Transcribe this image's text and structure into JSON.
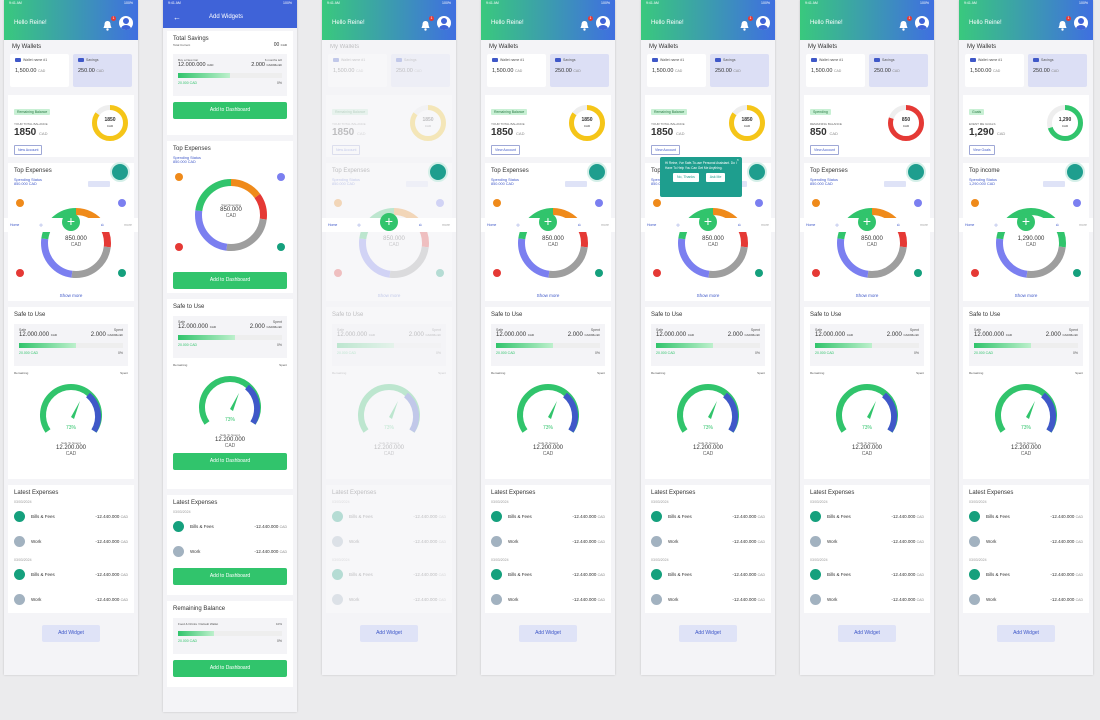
{
  "screens": [
    {
      "time": "9:41 AM",
      "battery": "100%",
      "greeting": "Hello Reine!",
      "notif": "1"
    },
    {
      "time": "9:41 AM",
      "battery": "100%",
      "title": "Add Widgets"
    }
  ],
  "wallets": {
    "title": "My Wallets",
    "items": [
      {
        "name": "Wallet name #1",
        "amount": "1,500.00",
        "cur": "CAD"
      },
      {
        "name": "Savings",
        "amount": "250.00",
        "cur": "CAD"
      }
    ]
  },
  "balance_widgets": [
    {
      "tag": "Remaining Balance",
      "label": "YOUR TOTAL BALANCE",
      "amount": "1850",
      "cur": "CAD",
      "button": "New Account"
    },
    {
      "tag": "Remaining Balance",
      "label": "YOUR TOTAL BALANCE",
      "amount": "1850",
      "cur": "CAD",
      "button": "View Account"
    },
    {
      "tag": "Spending",
      "label": "REMAINING BALANCE",
      "amount": "850",
      "cur": "CAD",
      "button": "View Account"
    },
    {
      "tag": "Goals",
      "label": "EVENT ME GOALS",
      "amount": "1,290",
      "cur": "CAD",
      "button": "View Goals"
    }
  ],
  "top_expenses": {
    "title": "Top Expenses",
    "status": "Spending Status",
    "amount": "850.000 CAD",
    "total": "850.000",
    "cur": "CAD",
    "show_more": "Show more",
    "center_label": "Total Spending"
  },
  "top_income": {
    "title": "Top income",
    "status": "Spending Status",
    "amount": "1,290.000 CAD",
    "total": "1,290.000",
    "cur": "CAD"
  },
  "nav": {
    "home": "Home",
    "more": "more"
  },
  "safe": {
    "title": "Safe to Use",
    "safe_lbl": "Safe",
    "spent_lbl": "Spent",
    "safe": "12.000.000",
    "safe_cur": "CAD",
    "spent": "2.000",
    "spent_cur": "CAD/Month",
    "prog_amt": "20.000 CAD",
    "prog_pct": "0%",
    "remaining": "Remaining",
    "spent2": "Spent",
    "pct": "73%",
    "status": "Safe To Spend",
    "total": "12.200.000",
    "cur": "CAD"
  },
  "latest": {
    "title": "Latest Expenses",
    "date": "03/03/2024",
    "items": [
      {
        "name": "Bills & Fees",
        "amount": "-12.440.000",
        "cur": "CAD"
      },
      {
        "name": "Work",
        "amount": "-12.440.000",
        "cur": "CAD"
      },
      {
        "name": "Bills & Fees",
        "amount": "-12.440.000",
        "cur": "CAD"
      },
      {
        "name": "Work",
        "amount": "-12.440.000",
        "cur": "CAD"
      }
    ]
  },
  "add_widget": "Add Widget",
  "add_dashboard": "Add to Dashboard",
  "widgets_page": {
    "total_savings": "Total Savings",
    "total_sub": "Total Current",
    "savings_count": "00",
    "savings_cur": "CAD",
    "goal_lbl": "Buy a New Car",
    "goal_period": "6 months left",
    "goal_amt": "12.000.000",
    "goal_cur": "CAD",
    "goal_spent": "2.000",
    "goal_spent_cur": "CAD/Month",
    "remaining_title": "Remaining Balance",
    "remaining_lbl": "Food & Drinks / Default Wallet",
    "remaining_pct": "10%"
  },
  "popup": {
    "text": "Hi Reine, I've Safe-To-use Personal Assistant. Do I Have To Help You Can Get Me Anything.",
    "no": "No, Thanks",
    "ok": "Ask Me"
  },
  "colors": {
    "green": "#31c46c",
    "blue": "#3f58c8",
    "teal": "#1e9e8e",
    "red": "#e53935",
    "yellow": "#f5c518"
  }
}
